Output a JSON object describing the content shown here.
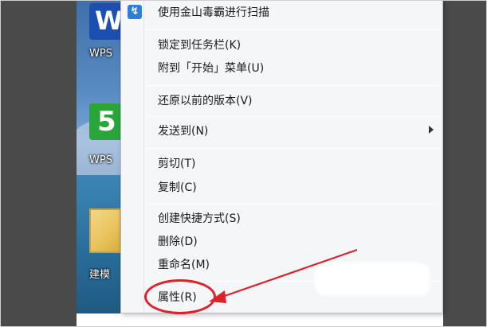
{
  "desktop": {
    "icons": [
      {
        "label": "WPS",
        "icon": "wps-writer-icon"
      },
      {
        "label": "WPS",
        "icon": "wps-spreadsheet-icon"
      },
      {
        "label": "建模",
        "icon": "folder-icon"
      }
    ]
  },
  "menu": {
    "items": [
      {
        "label": "使用金山毒霸进行扫描",
        "icon": "kingsoft-antivirus-icon"
      },
      {
        "label": "锁定到任务栏(K)"
      },
      {
        "label": "附到「开始」菜单(U)"
      },
      {
        "label": "还原以前的版本(V)"
      },
      {
        "label": "发送到(N)",
        "has_submenu": true
      },
      {
        "label": "剪切(T)"
      },
      {
        "label": "复制(C)"
      },
      {
        "label": "创建快捷方式(S)"
      },
      {
        "label": "删除(D)"
      },
      {
        "label": "重命名(M)"
      },
      {
        "label": "属性(R)",
        "highlighted": true
      }
    ]
  },
  "annotation": {
    "highlight_color": "#e0202a"
  }
}
